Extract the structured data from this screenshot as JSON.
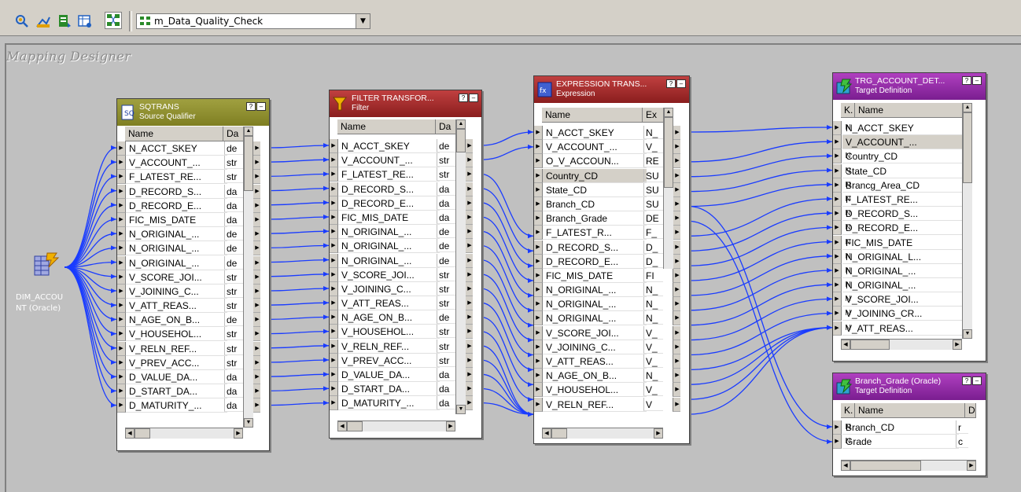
{
  "toolbar": {
    "icons": [
      "source-analyzer-icon",
      "target-designer-icon",
      "transformation-developer-icon",
      "mapplet-designer-icon",
      "mapping-designer-icon"
    ],
    "mapping_icon": "mapping-icon",
    "mapping_select_value": "m_Data_Quality_Check"
  },
  "workspace": {
    "title": "Mapping Designer"
  },
  "source": {
    "label_line1": "DIM_ACCOU",
    "label_line2": "NT (Oracle)"
  },
  "colors": {
    "wire": "#1a3cff",
    "sq_header": "#7f7f22",
    "filter_header": "#8a1e1e",
    "expr_header": "#8a1e1e",
    "target_header": "#7a1e90"
  },
  "sqtrans": {
    "title": "SQTRANS",
    "subtitle": "Source Qualifier",
    "col_name": "Name",
    "col_type": "Da",
    "rows": [
      {
        "name": "N_ACCT_SKEY",
        "type": "de"
      },
      {
        "name": "V_ACCOUNT_...",
        "type": "str"
      },
      {
        "name": "F_LATEST_RE...",
        "type": "str"
      },
      {
        "name": "D_RECORD_S...",
        "type": "da"
      },
      {
        "name": "D_RECORD_E...",
        "type": "da"
      },
      {
        "name": "FIC_MIS_DATE",
        "type": "da"
      },
      {
        "name": "N_ORIGINAL_...",
        "type": "de"
      },
      {
        "name": "N_ORIGINAL_...",
        "type": "de"
      },
      {
        "name": "N_ORIGINAL_...",
        "type": "de"
      },
      {
        "name": "V_SCORE_JOI...",
        "type": "str"
      },
      {
        "name": "V_JOINING_C...",
        "type": "str"
      },
      {
        "name": "V_ATT_REAS...",
        "type": "str"
      },
      {
        "name": "N_AGE_ON_B...",
        "type": "de"
      },
      {
        "name": "V_HOUSEHOL...",
        "type": "str"
      },
      {
        "name": "V_RELN_REF...",
        "type": "str"
      },
      {
        "name": "V_PREV_ACC...",
        "type": "str"
      },
      {
        "name": "D_VALUE_DA...",
        "type": "da"
      },
      {
        "name": "D_START_DA...",
        "type": "da"
      },
      {
        "name": "D_MATURITY_...",
        "type": "da"
      }
    ]
  },
  "filter": {
    "title": "FILTER TRANSFOR...",
    "subtitle": "Filter",
    "col_name": "Name",
    "col_type": "Da",
    "rows": [
      {
        "name": "N_ACCT_SKEY",
        "type": "de"
      },
      {
        "name": "V_ACCOUNT_...",
        "type": "str"
      },
      {
        "name": "F_LATEST_RE...",
        "type": "str"
      },
      {
        "name": "D_RECORD_S...",
        "type": "da"
      },
      {
        "name": "D_RECORD_E...",
        "type": "da"
      },
      {
        "name": "FIC_MIS_DATE",
        "type": "da"
      },
      {
        "name": "N_ORIGINAL_...",
        "type": "de"
      },
      {
        "name": "N_ORIGINAL_...",
        "type": "de"
      },
      {
        "name": "N_ORIGINAL_...",
        "type": "de"
      },
      {
        "name": "V_SCORE_JOI...",
        "type": "str"
      },
      {
        "name": "V_JOINING_C...",
        "type": "str"
      },
      {
        "name": "V_ATT_REAS...",
        "type": "str"
      },
      {
        "name": "N_AGE_ON_B...",
        "type": "de"
      },
      {
        "name": "V_HOUSEHOL...",
        "type": "str"
      },
      {
        "name": "V_RELN_REF...",
        "type": "str"
      },
      {
        "name": "V_PREV_ACC...",
        "type": "str"
      },
      {
        "name": "D_VALUE_DA...",
        "type": "da"
      },
      {
        "name": "D_START_DA...",
        "type": "da"
      },
      {
        "name": "D_MATURITY_...",
        "type": "da"
      }
    ]
  },
  "expression": {
    "title": "EXPRESSION TRANS...",
    "subtitle": "Expression",
    "col_name": "Name",
    "col_type": "Ex",
    "rows": [
      {
        "name": "N_ACCT_SKEY",
        "type": "N_"
      },
      {
        "name": "V_ACCOUNT_...",
        "type": "V_"
      },
      {
        "name": "O_V_ACCOUN...",
        "type": "RE"
      },
      {
        "name": "Country_CD",
        "type": "SU"
      },
      {
        "name": "State_CD",
        "type": "SU"
      },
      {
        "name": "Branch_CD",
        "type": "SU"
      },
      {
        "name": "Branch_Grade",
        "type": "DE"
      },
      {
        "name": "F_LATEST_R...",
        "type": "F_"
      },
      {
        "name": "D_RECORD_S...",
        "type": "D_"
      },
      {
        "name": "D_RECORD_E...",
        "type": "D_"
      },
      {
        "name": "FIC_MIS_DATE",
        "type": "FI"
      },
      {
        "name": "N_ORIGINAL_...",
        "type": "N_"
      },
      {
        "name": "N_ORIGINAL_...",
        "type": "N_"
      },
      {
        "name": "N_ORIGINAL_...",
        "type": "N_"
      },
      {
        "name": "V_SCORE_JOI...",
        "type": "V_"
      },
      {
        "name": "V_JOINING_C...",
        "type": "V_"
      },
      {
        "name": "V_ATT_REAS...",
        "type": "V_"
      },
      {
        "name": "N_AGE_ON_B...",
        "type": "N_"
      },
      {
        "name": "V_HOUSEHOL...",
        "type": "V_"
      },
      {
        "name": "V_RELN_REF...",
        "type": "V"
      }
    ]
  },
  "target_account": {
    "title": "TRG_ACCOUNT_DET...",
    "subtitle": "Target Definition",
    "col_key": "K.",
    "col_name": "Name",
    "rows": [
      {
        "key": "N",
        "name": "N_ACCT_SKEY"
      },
      {
        "key": "N",
        "name": "V_ACCOUNT_..."
      },
      {
        "key": "N",
        "name": "Country_CD"
      },
      {
        "key": "N",
        "name": "State_CD"
      },
      {
        "key": "N",
        "name": "Brancg_Area_CD"
      },
      {
        "key": "N",
        "name": "F_LATEST_RE..."
      },
      {
        "key": "N",
        "name": "D_RECORD_S..."
      },
      {
        "key": "N",
        "name": "D_RECORD_E..."
      },
      {
        "key": "N",
        "name": "FIC_MIS_DATE"
      },
      {
        "key": "N",
        "name": "N_ORIGINAL_L..."
      },
      {
        "key": "N",
        "name": "N_ORIGINAL_..."
      },
      {
        "key": "N",
        "name": "N_ORIGINAL_..."
      },
      {
        "key": "N",
        "name": "V_SCORE_JOI..."
      },
      {
        "key": "N",
        "name": "V_JOINING_CR..."
      },
      {
        "key": "N",
        "name": "V_ATT_REAS..."
      }
    ]
  },
  "target_branch": {
    "title": "Branch_Grade (Oracle)",
    "subtitle": "Target Definition",
    "col_key": "K.",
    "col_name": "Name",
    "col_type": "D",
    "rows": [
      {
        "key": "N",
        "name": "Branch_CD",
        "type": "r"
      },
      {
        "key": "N",
        "name": "Grade",
        "type": "c"
      }
    ]
  }
}
